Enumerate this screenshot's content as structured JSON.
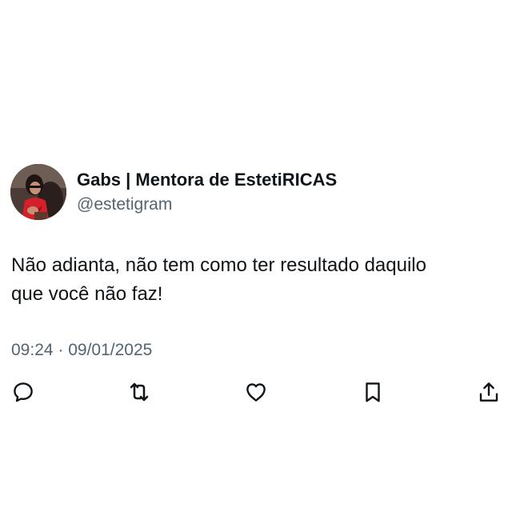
{
  "tweet": {
    "author": {
      "display_name": "Gabs | Mentora de EstetiRICAS",
      "handle": "@estetigram",
      "avatar_icon": "profile-photo"
    },
    "text_line_1": "Não adianta, não tem como ter resultado daquilo",
    "text_line_2": "que você não faz!",
    "timestamp": "09:24 · 09/01/2025",
    "actions": [
      {
        "name": "reply",
        "icon": "speech-bubble-icon"
      },
      {
        "name": "retweet",
        "icon": "retweet-arrows-icon"
      },
      {
        "name": "like",
        "icon": "heart-icon"
      },
      {
        "name": "bookmark",
        "icon": "bookmark-icon"
      },
      {
        "name": "share",
        "icon": "share-upload-icon"
      }
    ]
  },
  "colors": {
    "text_primary": "#0f1419",
    "text_secondary": "#536471",
    "background": "#ffffff"
  }
}
